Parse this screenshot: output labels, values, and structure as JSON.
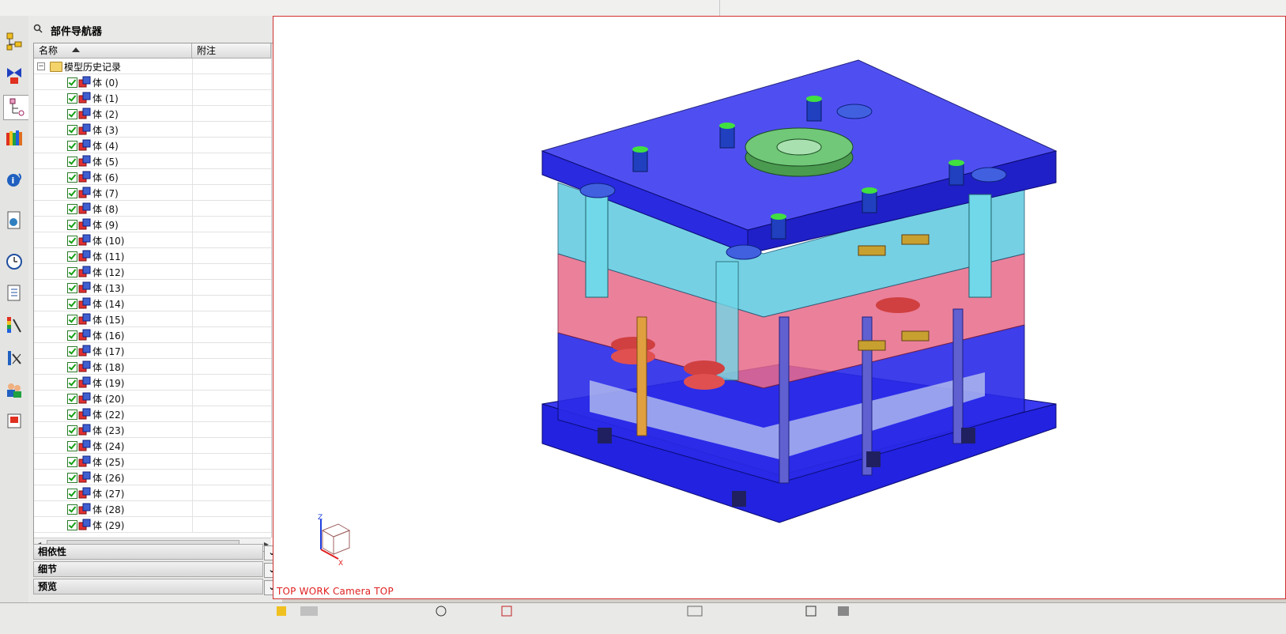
{
  "part_navigator": {
    "title": "部件导航器",
    "columns": [
      "名称",
      "附注"
    ],
    "root": "模型历史记录",
    "items": [
      "体 (0)",
      "体 (1)",
      "体 (2)",
      "体 (3)",
      "体 (4)",
      "体 (5)",
      "体 (6)",
      "体 (7)",
      "体 (8)",
      "体 (9)",
      "体 (10)",
      "体 (11)",
      "体 (12)",
      "体 (13)",
      "体 (14)",
      "体 (15)",
      "体 (16)",
      "体 (17)",
      "体 (18)",
      "体 (19)",
      "体 (20)",
      "体 (22)",
      "体 (23)",
      "体 (24)",
      "体 (25)",
      "体 (26)",
      "体 (27)",
      "体 (28)",
      "体 (29)"
    ],
    "sections": [
      "相依性",
      "细节",
      "预览"
    ]
  },
  "viewport": {
    "label": "TOP WORK Camera TOP",
    "triad_labels": {
      "z": "Z",
      "x": "X"
    }
  },
  "colors": {
    "plate_blue": "#2a2ae8",
    "plate_cyan": "#5ec8e0",
    "plate_pink": "#e86a8a",
    "accent_red": "#d03030"
  },
  "icons": [
    "assembly-navigator-icon",
    "constraint-navigator-icon",
    "part-navigator-icon",
    "reuse-library-icon",
    "hd3d-tools-icon",
    "web-browser-icon",
    "history-icon",
    "process-navigator-icon",
    "visualization-icon",
    "system-materials-icon",
    "roles-icon",
    "system-scenes-icon"
  ]
}
